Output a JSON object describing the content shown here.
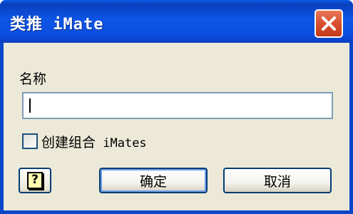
{
  "window": {
    "title": "类推 iMate"
  },
  "form": {
    "name_label": "名称",
    "name_value": "",
    "checkbox_label_cn": "创建组合",
    "checkbox_label_en": " iMates",
    "checkbox_checked": false
  },
  "buttons": {
    "help_label": "?",
    "ok_label": "确定",
    "cancel_label": "取消"
  },
  "colors": {
    "titlebar": "#0b4ee0",
    "close": "#d8502e",
    "client": "#ece9d8"
  }
}
